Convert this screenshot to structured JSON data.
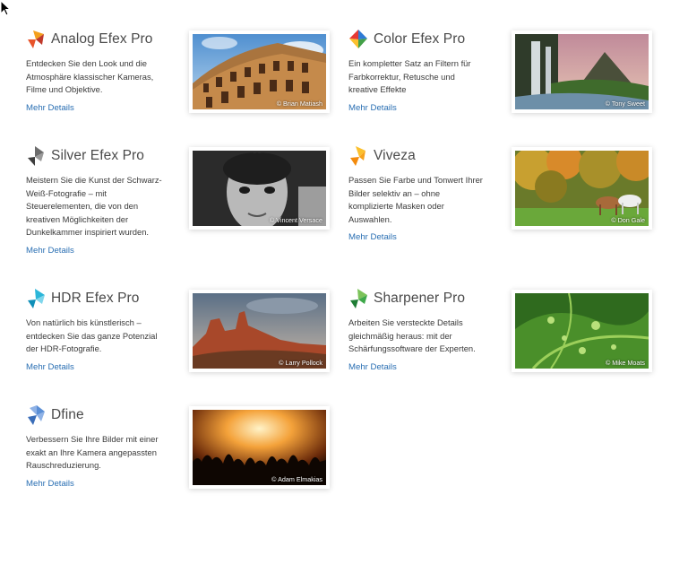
{
  "products": [
    {
      "key": "analog",
      "title": "Analog Efex Pro",
      "desc_lines": [
        "Entdecken Sie den Look und die",
        "Atmosphäre klassischer Kameras,",
        "Filme und Objektive."
      ],
      "more": "Mehr Details",
      "credit": "© Brian Matiash",
      "logo_colors": [
        "#e8542b",
        "#f4a01d",
        "#c0392b"
      ]
    },
    {
      "key": "color",
      "title": "Color Efex Pro",
      "desc_lines": [
        "Ein kompletter Satz an Filtern für",
        "Farbkorrektur, Retusche und",
        "kreative Effekte"
      ],
      "more": "Mehr Details",
      "credit": "© Tony Sweet",
      "logo_colors": [
        "#2e7bd6",
        "#e53935",
        "#43a047"
      ]
    },
    {
      "key": "silver",
      "title": "Silver Efex Pro",
      "desc_lines": [
        "Meistern Sie die Kunst der Schwarz-",
        "Weiß-Fotografie – mit",
        "Steuerelementen, die von den",
        "kreativen Möglichkeiten der",
        "Dunkelkammer inspiriert wurden."
      ],
      "more": "Mehr Details",
      "credit": "© Vincent Versace",
      "logo_colors": [
        "#6d6d6d",
        "#3d3d3d",
        "#9a9a9a"
      ]
    },
    {
      "key": "viveza",
      "title": "Viveza",
      "desc_lines": [
        "Passen Sie Farbe und Tonwert Ihrer",
        "Bilder selektiv an – ohne",
        "komplizierte Masken oder",
        "Auswahlen."
      ],
      "more": "Mehr Details",
      "credit": "© Don Gale",
      "logo_colors": [
        "#f7a21b",
        "#f38a0c",
        "#fbc02d"
      ]
    },
    {
      "key": "hdr",
      "title": "HDR Efex Pro",
      "desc_lines": [
        "Von natürlich bis künstlerisch –",
        "entdecken Sie das ganze Potenzial",
        "der HDR-Fotografie."
      ],
      "more": "Mehr Details",
      "credit": "© Larry Pollock",
      "logo_colors": [
        "#2bb6d9",
        "#0f8fb8",
        "#7fd6ec"
      ]
    },
    {
      "key": "sharpener",
      "title": "Sharpener Pro",
      "desc_lines": [
        "Arbeiten Sie versteckte Details",
        "gleichmäßig heraus: mit der",
        "Schärfungssoftware der Experten."
      ],
      "more": "Mehr Details",
      "credit": "© Mike Moats",
      "logo_colors": [
        "#3ea84a",
        "#1e7d34",
        "#7cc35a"
      ]
    },
    {
      "key": "dfine",
      "title": "Dfine",
      "desc_lines": [
        "Verbessern Sie Ihre Bilder mit einer",
        "exakt an Ihre Kamera angepassten",
        "Rauschreduzierung."
      ],
      "more": "Mehr Details",
      "credit": "© Adam Elmakias",
      "logo_colors": [
        "#5b8fd6",
        "#3a6db8",
        "#8fb2e6"
      ]
    }
  ]
}
